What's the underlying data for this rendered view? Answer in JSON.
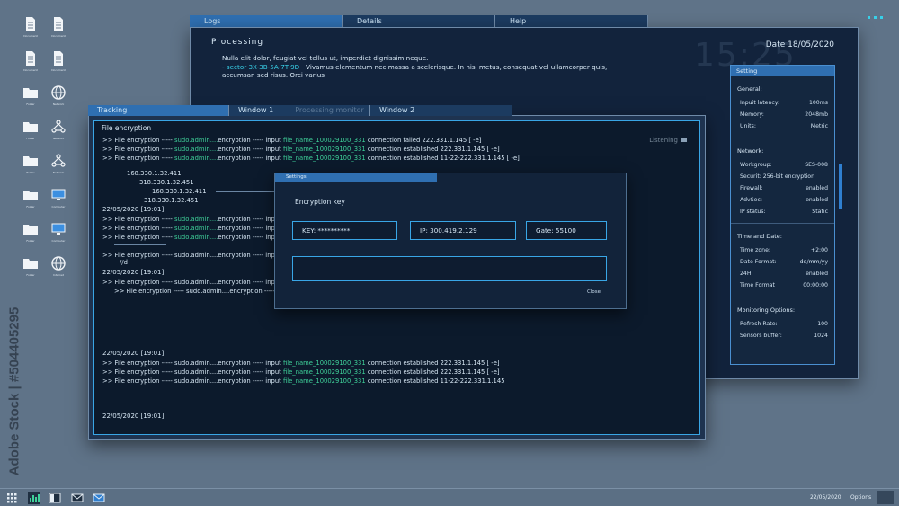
{
  "desktop": {
    "icons": [
      {
        "name": "document-icon",
        "label": "Document"
      },
      {
        "name": "document-icon",
        "label": "Document"
      },
      {
        "name": "document-icon",
        "label": "Document"
      },
      {
        "name": "document-icon",
        "label": "Document"
      },
      {
        "name": "folder-icon",
        "label": "Folder"
      },
      {
        "name": "globe-icon",
        "label": "Network"
      },
      {
        "name": "folder-icon",
        "label": "Folder"
      },
      {
        "name": "network-icon",
        "label": "Network"
      },
      {
        "name": "folder-icon",
        "label": "Folder"
      },
      {
        "name": "network-icon",
        "label": "Network"
      },
      {
        "name": "folder-icon",
        "label": "Folder"
      },
      {
        "name": "monitor-icon",
        "label": "Computer"
      },
      {
        "name": "folder-icon",
        "label": "Folder"
      },
      {
        "name": "monitor-icon",
        "label": "Computer"
      },
      {
        "name": "folder-icon",
        "label": "Folder"
      },
      {
        "name": "globe-icon",
        "label": "Internet"
      }
    ]
  },
  "watermark": "Adobe Stock | #504405295",
  "back_window": {
    "tabs": [
      "Logs",
      "Details",
      "Help"
    ],
    "title": "Processing",
    "date": "Date 18/05/2020",
    "clock": "15:25",
    "line1": "Nulla elit dolor, feugiat vel tellus ut, imperdiet dignissim neque.",
    "sector": "- sector 3X-3B-5A-7T-9D",
    "line2": "Vivamus elementum nec massa a scelerisque. In nisl metus, consequat vel ullamcorper quis,",
    "line3": "accumsan sed risus. Orci varius"
  },
  "setting_panel": {
    "header": "Setting",
    "general_title": "General:",
    "general": [
      {
        "k": "Inpuit latency:",
        "v": "100ms"
      },
      {
        "k": "Memory:",
        "v": "2048mb"
      },
      {
        "k": "Units:",
        "v": "Metric"
      }
    ],
    "network_title": "Network:",
    "network_workgroup": {
      "k": "Workgroup:",
      "v": "SES-008"
    },
    "network_security": "Securit: 256-bit encryption",
    "network": [
      {
        "k": "Firewall:",
        "v": "enabled"
      },
      {
        "k": "AdvSec:",
        "v": "enabled"
      },
      {
        "k": "IP status:",
        "v": "Static"
      }
    ],
    "time_title": "Time and Date:",
    "time": [
      {
        "k": "Time zone:",
        "v": "+2:00"
      },
      {
        "k": "Date Format:",
        "v": "dd/mm/yy"
      },
      {
        "k": "24H:",
        "v": "enabled"
      },
      {
        "k": "Time Format",
        "v": "00:00:00"
      }
    ],
    "monitor_title": "Monitoring Options:",
    "monitor": [
      {
        "k": "Refresh Rate:",
        "v": "100"
      },
      {
        "k": "Sensors buffer:",
        "v": "1024"
      }
    ]
  },
  "front_window": {
    "tabs": [
      "Tracking",
      "Window 1",
      "Window 2"
    ],
    "ghost_tab": "Processing monitor",
    "title": "File encryption",
    "listening": "Listening",
    "log1": [
      {
        "pre": ">> File encryption ----- ",
        "user": "sudo.admin....",
        "mid": "encryption ----- input ",
        "file": "file_name_100029100_331",
        "post": " connection failed 222.331.1.145 [ -e]"
      },
      {
        "pre": ">> File encryption ----- ",
        "user": "sudo.admin....",
        "mid": "encryption ----- input ",
        "file": "file_name_100029100_331",
        "post": " connection established 222.331.1.145 [ -e]"
      },
      {
        "pre": ">> File encryption ----- ",
        "user": "sudo.admin....",
        "mid": "encryption ----- input ",
        "file": "file_name_100029100_331",
        "post": " connection established 11-22-222.331.1.145 [ -e]"
      }
    ],
    "ips": [
      "168.330.1.32.411",
      "318.330.1.32.451",
      "168.330.1.32.411",
      "318.330.1.32.451"
    ],
    "date1": "22/05/2020 [19:01]",
    "log2": [
      {
        "pre": ">> File encryption ----- ",
        "user": "sudo.admin....",
        "mid": "encryption ----- inpu",
        "file": "",
        "post": ""
      },
      {
        "pre": ">> File encryption ----- ",
        "user": "sudo.admin....",
        "mid": "encryption ----- inpu",
        "file": "",
        "post": ""
      },
      {
        "pre": ">> File encryption ----- ",
        "user": "sudo.admin....",
        "mid": "encryption ----- inpu",
        "file": "",
        "post": ""
      }
    ],
    "log3_line": ">> File encryption ----- sudo.admin....encryption ----- inpu",
    "log3_sub": "//d",
    "date2": "22/05/2020 [19:01]",
    "log4_a": ">> File encryption ----- sudo.admin....encryption ----- inpu",
    "log4_b": ">> File encryption ----- sudo.admin....encryption ----- inpu",
    "date3": "22/05/2020 [19:01]",
    "log5": [
      {
        "pre": ">> File encryption ----- sudo.admin....encryption ----- input ",
        "file": "file_name_100029100_331",
        "post": " connection established 222.331.1.145 [ -e]"
      },
      {
        "pre": ">> File encryption ----- sudo.admin....encryption ----- input ",
        "file": "file_name_100029100_331",
        "post": " connection established 222.331.1.145 [ -e]"
      },
      {
        "pre": ">> File encryption ----- sudo.admin....encryption ----- input ",
        "file": "file_name_100029100_331",
        "post": " connection established 11-22-222.331.1.145"
      }
    ],
    "date4": "22/05/2020 [19:01]"
  },
  "dialog": {
    "header": "Settings",
    "title": "Encryption key",
    "key_field": "KEY: **********",
    "ip_field": "IP: 300.419.2.129",
    "gate_field": "Gate: 55100",
    "input_value": "",
    "close_label": "Close"
  },
  "taskbar": {
    "date": "22/05/2020",
    "options": "Options"
  }
}
